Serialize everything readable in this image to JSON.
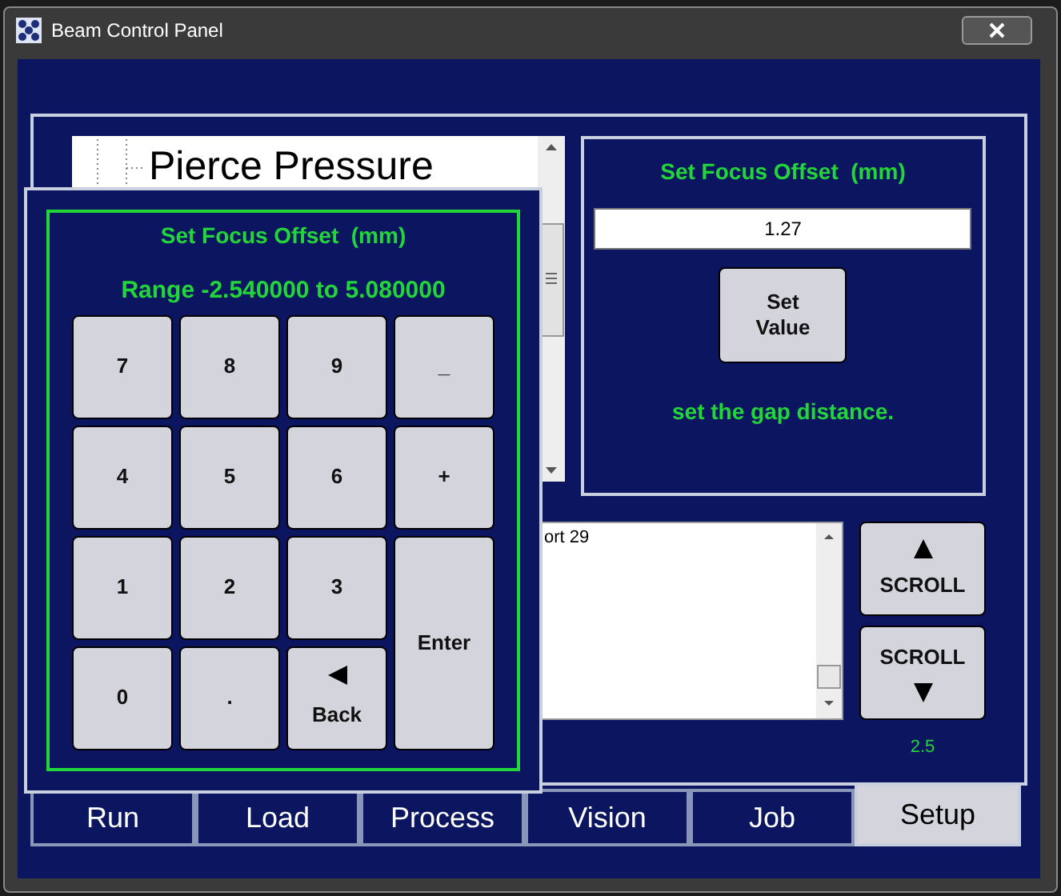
{
  "window": {
    "title": "Beam Control Panel"
  },
  "list": {
    "items": [
      {
        "label": "Pierce Pressure"
      }
    ]
  },
  "setting_panel": {
    "title": "Set Focus Offset  (mm)",
    "value": "1.27",
    "button": "Set Value",
    "hint": "set the gap distance."
  },
  "log": {
    "lines": [
      "ort 29"
    ]
  },
  "scroll_buttons": [
    {
      "label": "SCROLL",
      "kind": "up"
    },
    {
      "label": "SCROLL",
      "kind": "down"
    }
  ],
  "status_value": "2.5",
  "tabs": [
    {
      "label": "Run",
      "selected": false
    },
    {
      "label": "Load",
      "selected": false
    },
    {
      "label": "Process",
      "selected": false
    },
    {
      "label": "Vision",
      "selected": false
    },
    {
      "label": "Job",
      "selected": false
    },
    {
      "label": "Setup",
      "selected": true
    }
  ],
  "keypad": {
    "title": "Set Focus Offset  (mm)",
    "range": "Range -2.540000 to 5.080000",
    "keys": [
      {
        "label": "7",
        "kind": "key"
      },
      {
        "label": "8",
        "kind": "key"
      },
      {
        "label": "9",
        "kind": "key"
      },
      {
        "label": "_",
        "kind": "key"
      },
      {
        "label": "4",
        "kind": "key"
      },
      {
        "label": "5",
        "kind": "key"
      },
      {
        "label": "6",
        "kind": "key"
      },
      {
        "label": "+",
        "kind": "key"
      },
      {
        "label": "1",
        "kind": "key"
      },
      {
        "label": "2",
        "kind": "key"
      },
      {
        "label": "3",
        "kind": "key"
      },
      {
        "label": "Enter",
        "kind": "tall"
      },
      {
        "label": "0",
        "kind": "key"
      },
      {
        "label": ".",
        "kind": "key"
      },
      {
        "label": "Back",
        "kind": "back"
      }
    ]
  }
}
